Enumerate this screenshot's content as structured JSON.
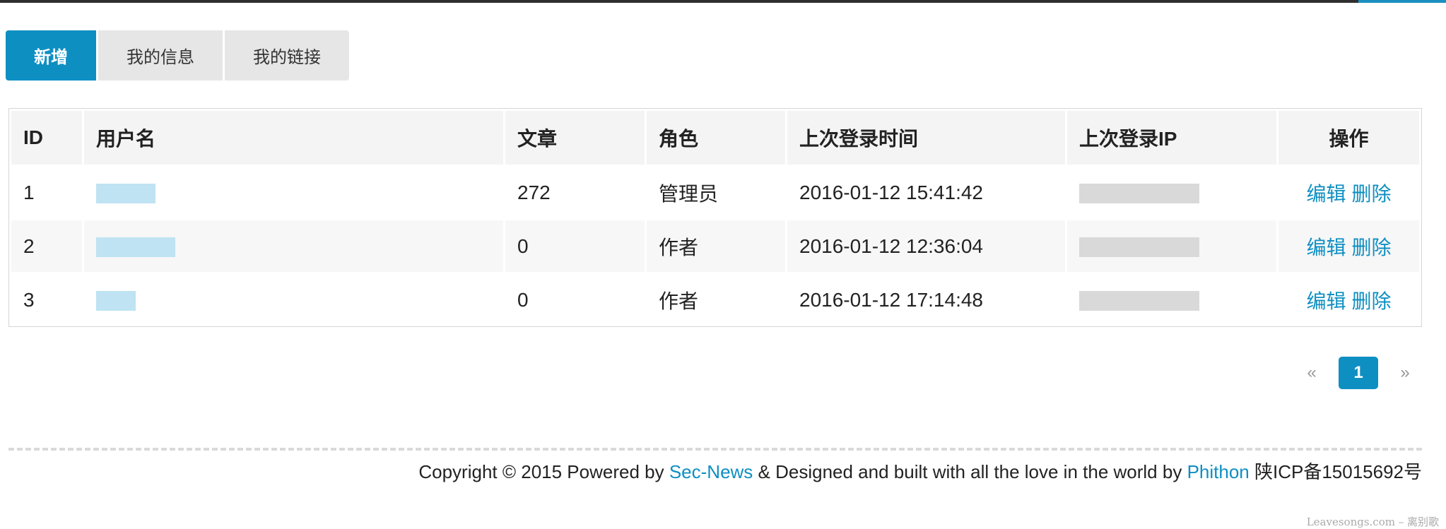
{
  "tabs": [
    {
      "label": "新增"
    },
    {
      "label": "我的信息"
    },
    {
      "label": "我的链接"
    }
  ],
  "table": {
    "columns": [
      "ID",
      "用户名",
      "文章",
      "角色",
      "上次登录时间",
      "上次登录IP",
      "操作"
    ],
    "rows": [
      {
        "id": "1",
        "posts": "272",
        "role": "管理员",
        "last_login": "2016-01-12 15:41:42"
      },
      {
        "id": "2",
        "posts": "0",
        "role": "作者",
        "last_login": "2016-01-12 12:36:04"
      },
      {
        "id": "3",
        "posts": "0",
        "role": "作者",
        "last_login": "2016-01-12 17:14:48"
      }
    ],
    "actions": {
      "edit": "编辑",
      "delete": "删除"
    }
  },
  "pagination": {
    "prev": "«",
    "current": "1",
    "next": "»"
  },
  "footer": {
    "t1": "Copyright © 2015 Powered by ",
    "link1": "Sec-News",
    "t2": " & Designed and built with all the love in the world by ",
    "link2": "Phithon",
    "t3": " 陕ICP备15015692号"
  },
  "watermark": "Leavesongs.com – 离别歌",
  "colors": {
    "accent": "#0e8fc2",
    "tab_bg": "#e6e6e6",
    "header_bg": "#f4f4f4"
  }
}
